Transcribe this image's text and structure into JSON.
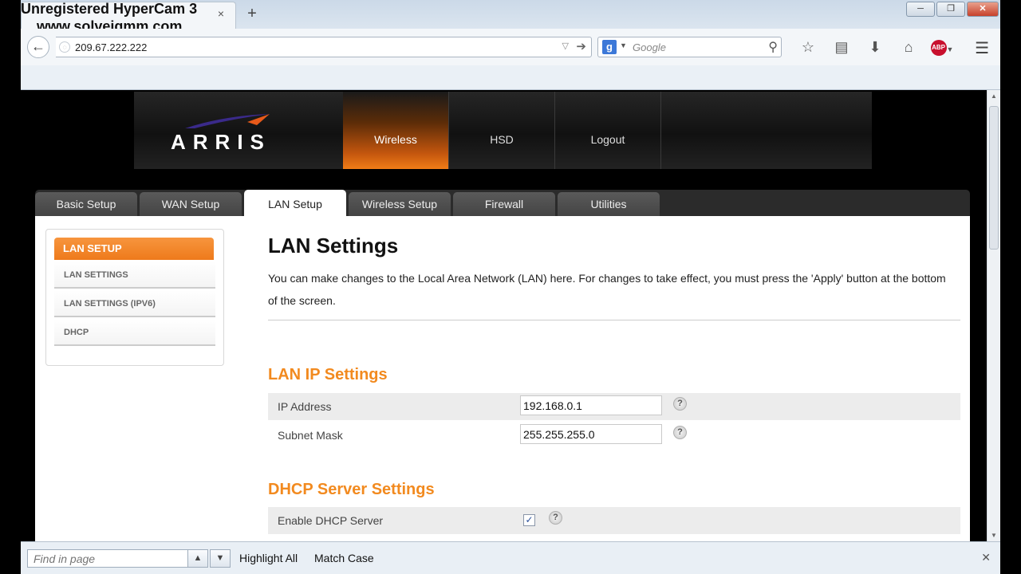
{
  "watermark": {
    "line1": "Unregistered HyperCam 3",
    "line2": "www.solveigmm.com"
  },
  "browser": {
    "url": "209.67.222.222",
    "search_placeholder": "Google",
    "tab_close": "×",
    "new_tab": "+",
    "win_min": "─",
    "win_max": "❐",
    "win_close": "✕"
  },
  "header": {
    "logo": "ARRIS",
    "nav": [
      {
        "label": "Wireless",
        "active": true
      },
      {
        "label": "HSD",
        "active": false
      },
      {
        "label": "Logout",
        "active": false
      }
    ]
  },
  "subtabs": [
    {
      "label": "Basic Setup"
    },
    {
      "label": "WAN Setup"
    },
    {
      "label": "LAN Setup",
      "active": true
    },
    {
      "label": "Wireless Setup"
    },
    {
      "label": "Firewall"
    },
    {
      "label": "Utilities"
    }
  ],
  "sidebar": {
    "title": "LAN SETUP",
    "items": [
      {
        "label": "LAN SETTINGS"
      },
      {
        "label": "LAN SETTINGS (IPV6)"
      },
      {
        "label": "DHCP"
      }
    ]
  },
  "main": {
    "title": "LAN Settings",
    "description": "You can make changes to the Local Area Network (LAN) here. For changes to take effect, you must press the 'Apply' button at the bottom of the screen.",
    "lan_ip_title": "LAN IP Settings",
    "ip_label": "IP Address",
    "ip_value": "192.168.0.1",
    "mask_label": "Subnet Mask",
    "mask_value": "255.255.255.0",
    "dhcp_title": "DHCP Server Settings",
    "dhcp_enable_label": "Enable DHCP Server",
    "help": "?"
  },
  "findbar": {
    "placeholder": "Find in page",
    "highlight_all": "Highlight All",
    "match_case": "Match Case"
  }
}
